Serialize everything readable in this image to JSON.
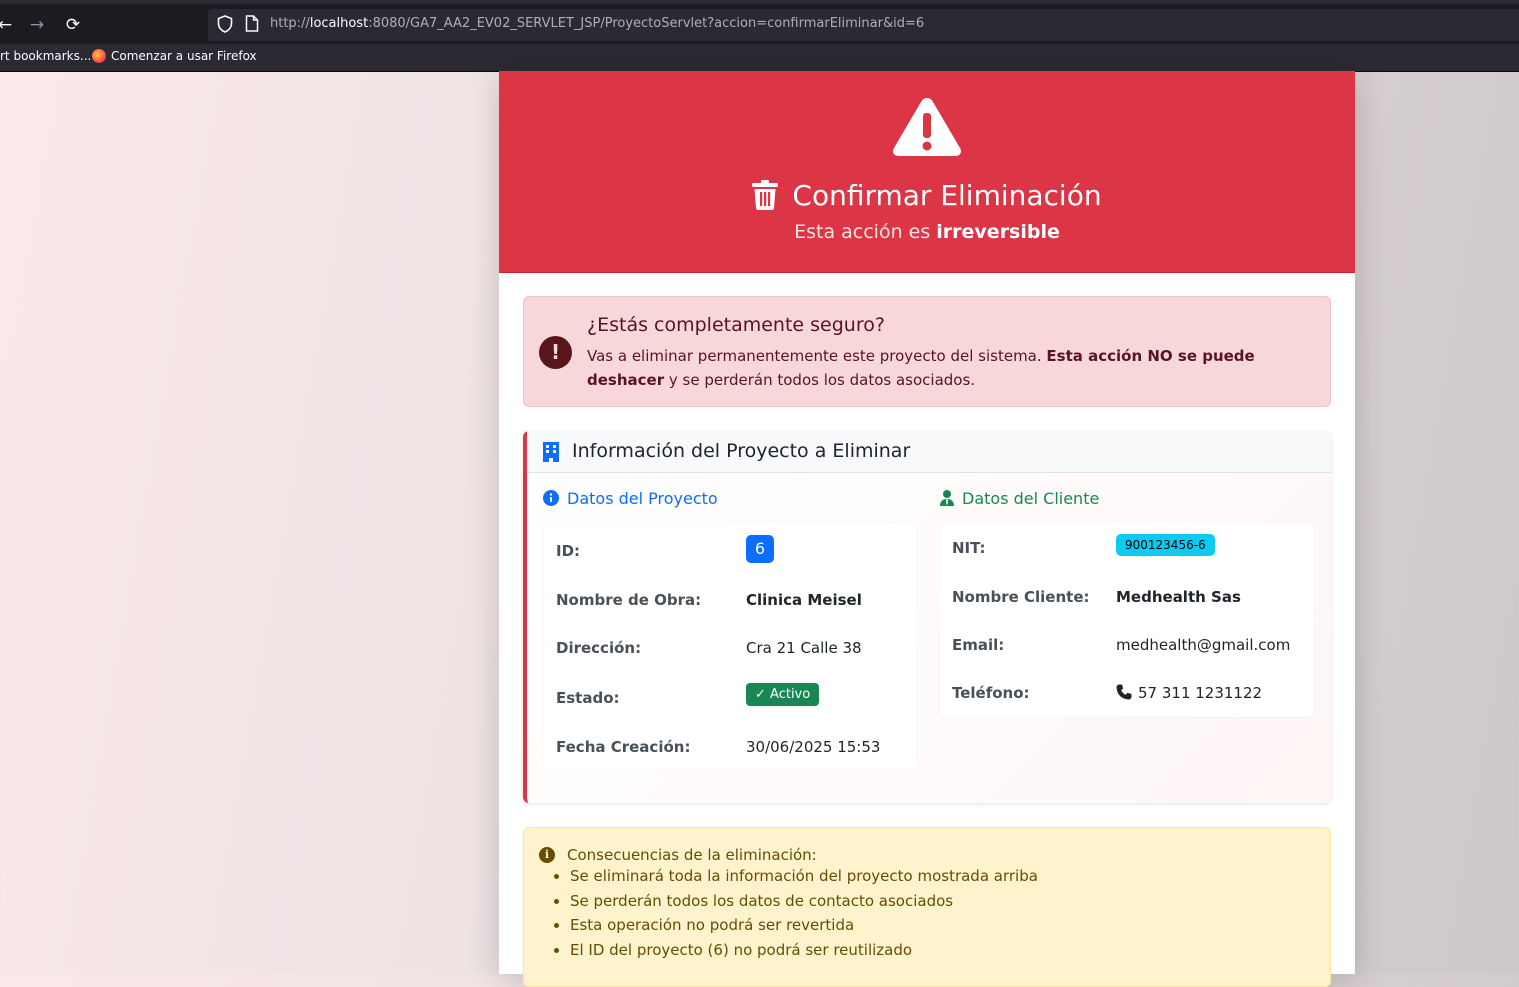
{
  "browser": {
    "url_prefix": "http://",
    "url_host": "localhost",
    "url_rest": ":8080/GA7_AA2_EV02_SERVLET_JSP/ProyectoServlet?accion=confirmarEliminar&id=6",
    "bookmarks": [
      "rt bookmarks...",
      "Comenzar a usar Firefox"
    ]
  },
  "header": {
    "title": "Confirmar Eliminación",
    "subtitle_prefix": "Esta acción es ",
    "subtitle_strong": "irreversible"
  },
  "danger_alert": {
    "heading": "¿Estás completamente seguro?",
    "text_before": "Vas a eliminar permanentemente este proyecto del sistema. ",
    "text_strong": "Esta acción NO se puede deshacer",
    "text_after": " y se perderán todos los datos asociados."
  },
  "project_info": {
    "heading": "Información del Proyecto a Eliminar",
    "project_section": {
      "title": "Datos del Proyecto",
      "id_label": "ID:",
      "id_value": "6",
      "name_label": "Nombre de Obra:",
      "name_value": "Clinica Meisel",
      "address_label": "Dirección:",
      "address_value": "Cra 21 Calle 38",
      "status_label": "Estado:",
      "status_value": "Activo",
      "date_label": "Fecha Creación:",
      "date_value": "30/06/2025 15:53"
    },
    "client_section": {
      "title": "Datos del Cliente",
      "nit_label": "NIT:",
      "nit_value": "900123456-6",
      "client_label": "Nombre Cliente:",
      "client_value": "Medhealth Sas",
      "email_label": "Email:",
      "email_value": "medhealth@gmail.com",
      "phone_label": "Teléfono:",
      "phone_value": "57 311 1231122"
    }
  },
  "warning_alert": {
    "heading": "Consecuencias de la eliminación:",
    "items": [
      "Se eliminará toda la información del proyecto mostrada arriba",
      "Se perderán todos los datos de contacto asociados",
      "Esta operación no podrá ser revertida",
      "El ID del proyecto (6) no podrá ser reutilizado"
    ]
  },
  "colors": {
    "danger": "#dc3545",
    "primary": "#0d6efd",
    "success": "#198754",
    "info": "#0dcaf0",
    "warning_bg": "#fff3cd"
  }
}
